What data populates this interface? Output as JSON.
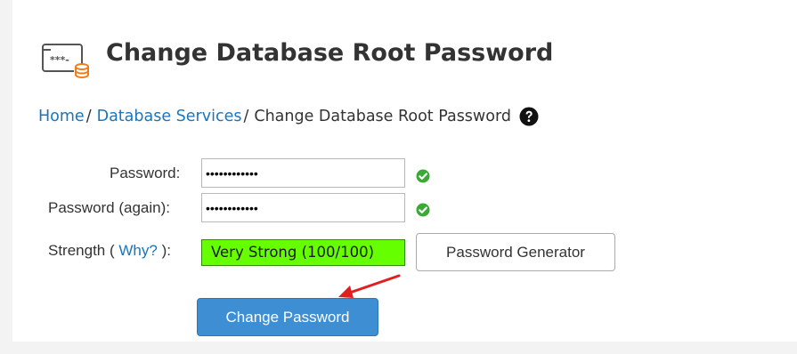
{
  "header": {
    "title": "Change Database Root Password",
    "icon": "database-password-icon"
  },
  "breadcrumb": {
    "home": "Home",
    "section": "Database Services",
    "current": "Change Database Root Password",
    "separator": "/",
    "help_icon": "question-circle-icon"
  },
  "form": {
    "password_label": "Password:",
    "password_value": "••••••••••••",
    "password_again_label": "Password (again):",
    "password_again_value": "••••••••••••",
    "strength_prefix": "Strength (",
    "why_link": "Why?",
    "strength_suffix": "):",
    "strength_value": "Very Strong (100/100)",
    "strength_percent": 100,
    "generator_label": "Password Generator",
    "submit_label": "Change Password",
    "valid_icon": "check-circle-icon"
  },
  "colors": {
    "link": "#1b75bb",
    "strength_bg": "#66ff00",
    "valid_green": "#3aa935",
    "primary_button": "#3d8ed2",
    "annotation_arrow": "#e02020"
  }
}
